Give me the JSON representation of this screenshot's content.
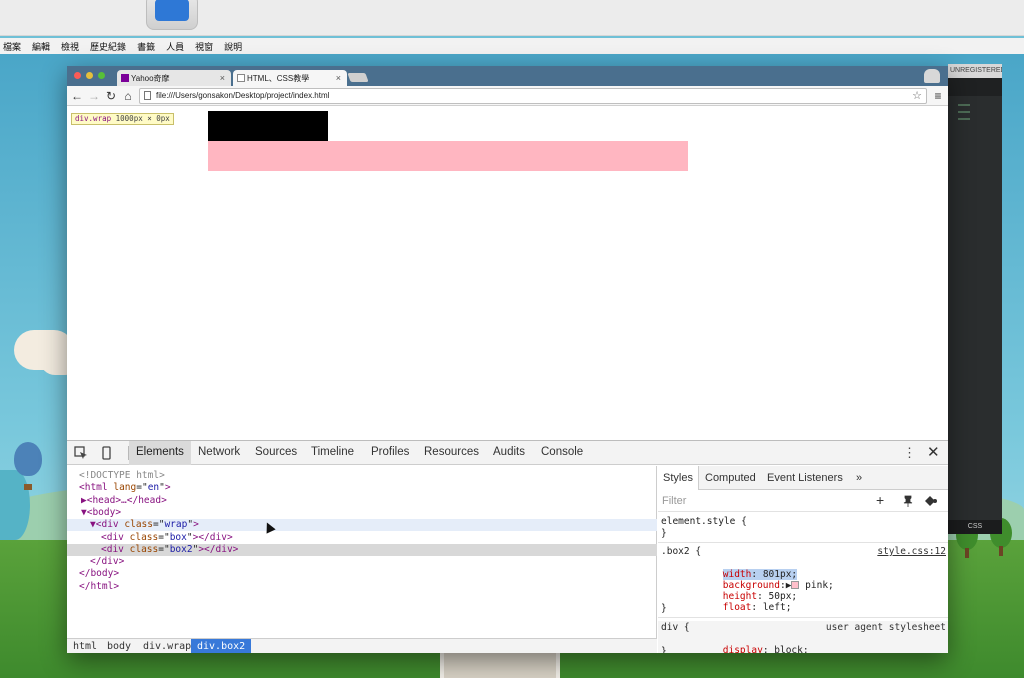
{
  "menubar": [
    "檔案",
    "編輯",
    "檢視",
    "歷史紀錄",
    "書籤",
    "人員",
    "視窗",
    "說明"
  ],
  "editor": {
    "unregistered": "UNREGISTERED",
    "status": "CSS"
  },
  "tabs": [
    {
      "title": "Yahoo奇摩",
      "close": "×"
    },
    {
      "title": "HTML、CSS教學",
      "close": "×"
    }
  ],
  "toolbar": {
    "url": "file:///Users/gonsakon/Desktop/project/index.html"
  },
  "page": {
    "tooltip": {
      "selector": "div.wrap",
      "size": "1000px × 0px"
    },
    "colors": {
      "box": "#000000",
      "box2": "#ffb6c1"
    }
  },
  "devtools": {
    "tabs": [
      "Elements",
      "Network",
      "Sources",
      "Timeline",
      "Profiles",
      "Resources",
      "Audits",
      "Console"
    ],
    "dom": [
      {
        "indent": 0,
        "kind": "doctype",
        "text": "<!DOCTYPE html>"
      },
      {
        "indent": 0,
        "kind": "open",
        "tag": "html",
        "attr": "lang",
        "val": "en",
        "suffix": ">"
      },
      {
        "indent": 0,
        "kind": "collapsed",
        "text": "▶<head>…</head>"
      },
      {
        "indent": 0,
        "kind": "plain",
        "text": "▼<body>"
      },
      {
        "indent": 1,
        "kind": "open",
        "tag": "div",
        "attr": "class",
        "val": "wrap",
        "suffix": ">",
        "prefix": "▼"
      },
      {
        "indent": 2,
        "kind": "full",
        "tag": "div",
        "attr": "class",
        "val": "box"
      },
      {
        "indent": 2,
        "kind": "full",
        "tag": "div",
        "attr": "class",
        "val": "box2"
      },
      {
        "indent": 1,
        "kind": "plain",
        "text": "</div>"
      },
      {
        "indent": 0,
        "kind": "plain",
        "text": "</body>"
      },
      {
        "indent": 0,
        "kind": "plain",
        "text": "</html>"
      }
    ],
    "breadcrumbs": [
      "html",
      "body",
      "div.wrap",
      "div.box2"
    ],
    "styles": {
      "tabs": [
        "Styles",
        "Computed",
        "Event Listeners",
        "»"
      ],
      "filter_placeholder": "Filter",
      "element_style": "element.style {",
      "close_brace": "}",
      "box2_selector": ".box2 {",
      "box2_source": "style.css:12",
      "box2_props": [
        {
          "name": "width",
          "value": "801px;"
        },
        {
          "name": "background",
          "value": "pink;"
        },
        {
          "name": "height",
          "value": "50px;"
        },
        {
          "name": "float",
          "value": "left;"
        }
      ],
      "div_selector": "div {",
      "div_source": "user agent stylesheet",
      "div_prop": {
        "name": "display",
        "value": "block;"
      }
    }
  }
}
